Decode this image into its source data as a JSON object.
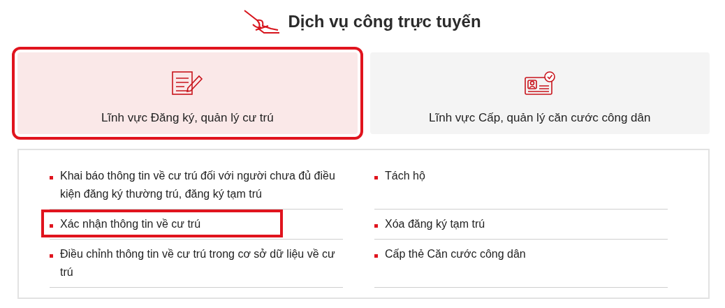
{
  "header": {
    "title": "Dịch vụ công trực tuyến"
  },
  "tabs": [
    {
      "label": "Lĩnh vực Đăng ký, quản lý cư trú",
      "kind": "document",
      "selected": true
    },
    {
      "label": "Lĩnh vực Cấp, quản lý căn cước công dân",
      "kind": "idcard",
      "selected": false
    }
  ],
  "services": {
    "columns": [
      [
        {
          "label": "Khai báo thông tin về cư trú đối với người chưa đủ điều kiện đăng ký thường trú, đăng ký tạm trú",
          "highlighted": false
        },
        {
          "label": "Xác nhận thông tin về cư trú",
          "highlighted": true
        },
        {
          "label": "Điều chỉnh thông tin về cư trú trong cơ sở dữ liệu về cư trú",
          "highlighted": false
        }
      ],
      [
        {
          "label": "Tách hộ",
          "highlighted": false
        },
        {
          "label": "Xóa đăng ký tạm trú",
          "highlighted": false
        },
        {
          "label": "Cấp thẻ Căn cước công dân",
          "highlighted": false
        }
      ]
    ]
  }
}
